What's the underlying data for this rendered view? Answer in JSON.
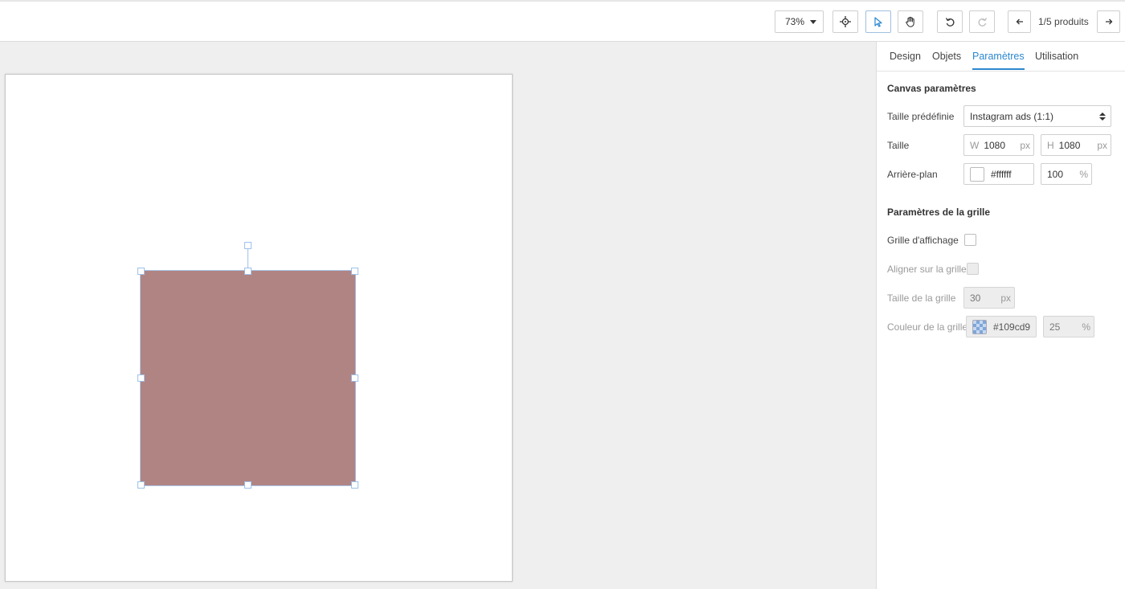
{
  "toolbar": {
    "zoom_value": "73%",
    "page_indicator": "1/5 produits"
  },
  "tabs": [
    {
      "label": "Design",
      "active": false
    },
    {
      "label": "Objets",
      "active": false
    },
    {
      "label": "Paramètres",
      "active": true
    },
    {
      "label": "Utilisation",
      "active": false
    }
  ],
  "canvas_settings": {
    "title": "Canvas paramètres",
    "preset_label": "Taille prédéfinie",
    "preset_value": "Instagram ads (1:1)",
    "size_label": "Taille",
    "width_prefix": "W",
    "width_value": "1080",
    "width_unit": "px",
    "height_prefix": "H",
    "height_value": "1080",
    "height_unit": "px",
    "background_label": "Arrière-plan",
    "background_color": "#ffffff",
    "background_display": "#ffffff",
    "background_opacity": "100",
    "opacity_unit": "%"
  },
  "grid_settings": {
    "title": "Paramètres de la grille",
    "show_grid_label": "Grille d'affichage",
    "show_grid_checked": false,
    "snap_label": "Aligner sur la grille",
    "snap_checked": false,
    "grid_size_label": "Taille de la grille",
    "grid_size_value": "30",
    "grid_size_unit": "px",
    "grid_color_label": "Couleur de la grille",
    "grid_color_value": "#109cd9",
    "grid_opacity": "25",
    "opacity_unit": "%"
  },
  "canvas": {
    "shape_color": "#b18484",
    "artboard_color": "#ffffff"
  },
  "colors": {
    "accent": "#2b87d0",
    "selection": "#9ec1ea"
  }
}
